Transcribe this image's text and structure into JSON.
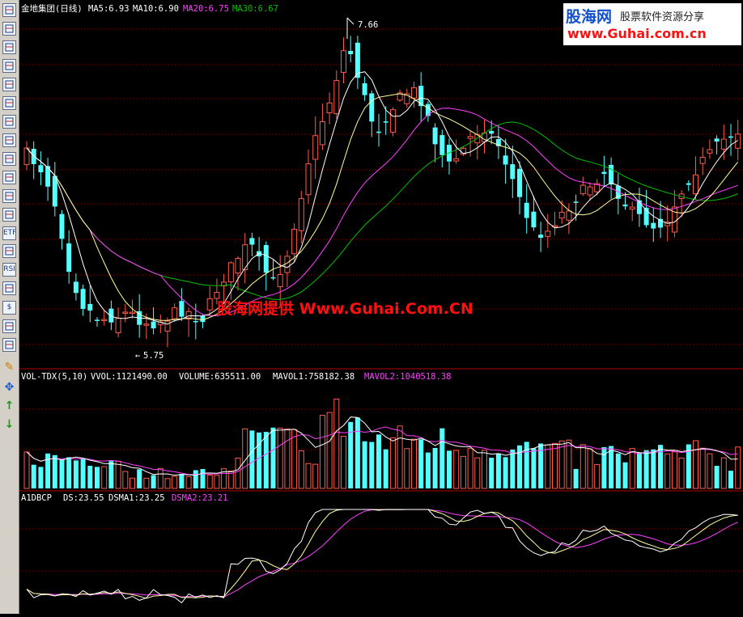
{
  "toolbar": {
    "icons": [
      "grid-icon",
      "list-icon",
      "line-chart-icon",
      "candle-chart-icon",
      "bar-chart-icon",
      "report-icon",
      "table-icon",
      "document-icon",
      "mail-icon",
      "people-icon",
      "fundamental-icon",
      "search-icon",
      "etf-icon",
      "indicator-icon",
      "rsi-icon",
      "screen-icon",
      "money-icon",
      "tools-icon",
      "export-icon",
      "pencil-icon",
      "move-icon",
      "arrow-up-icon",
      "arrow-down-icon"
    ],
    "labels": [
      "",
      "",
      "",
      "",
      "",
      "",
      "",
      "",
      "",
      "",
      "",
      "",
      "ETF",
      "",
      "RSI",
      "",
      "$",
      "",
      "",
      "",
      "",
      "↑",
      "↓"
    ]
  },
  "price_panel": {
    "title": "金地集团(日线)",
    "ma5": "MA5:6.93",
    "ma10": "MA10:6.90",
    "ma20": "MA20:6.75",
    "ma30": "MA30:6.67",
    "high_marker": "7.66",
    "low_marker": "5.75"
  },
  "volume_panel": {
    "title": "VOL-TDX(5,10)",
    "vvol": "VVOL:1121490.00",
    "volume": "VOLUME:635511.00",
    "mavol1": "MAVOL1:758182.38",
    "mavol2": "MAVOL2:1040518.38"
  },
  "indicator_panel": {
    "title": "A1DBCP",
    "ds": "DS:23.55",
    "dsma1": "DSMA1:23.25",
    "dsma2": "DSMA2:23.21"
  },
  "watermark": {
    "logo_main": "股海网",
    "logo_sub": "股票软件资源分享",
    "logo_url": "www.Guhai.com.cn",
    "center_text": "股海网提供 Www.Guhai.Com.CN"
  },
  "colors": {
    "up": "#ff5a4a",
    "down": "#54ffff",
    "ma5": "#ffffff",
    "ma10": "#ffff9a",
    "ma20": "#ff40ff",
    "ma30": "#00c000",
    "grid": "#8b0000",
    "watermark_red": "#ff1010"
  }
}
